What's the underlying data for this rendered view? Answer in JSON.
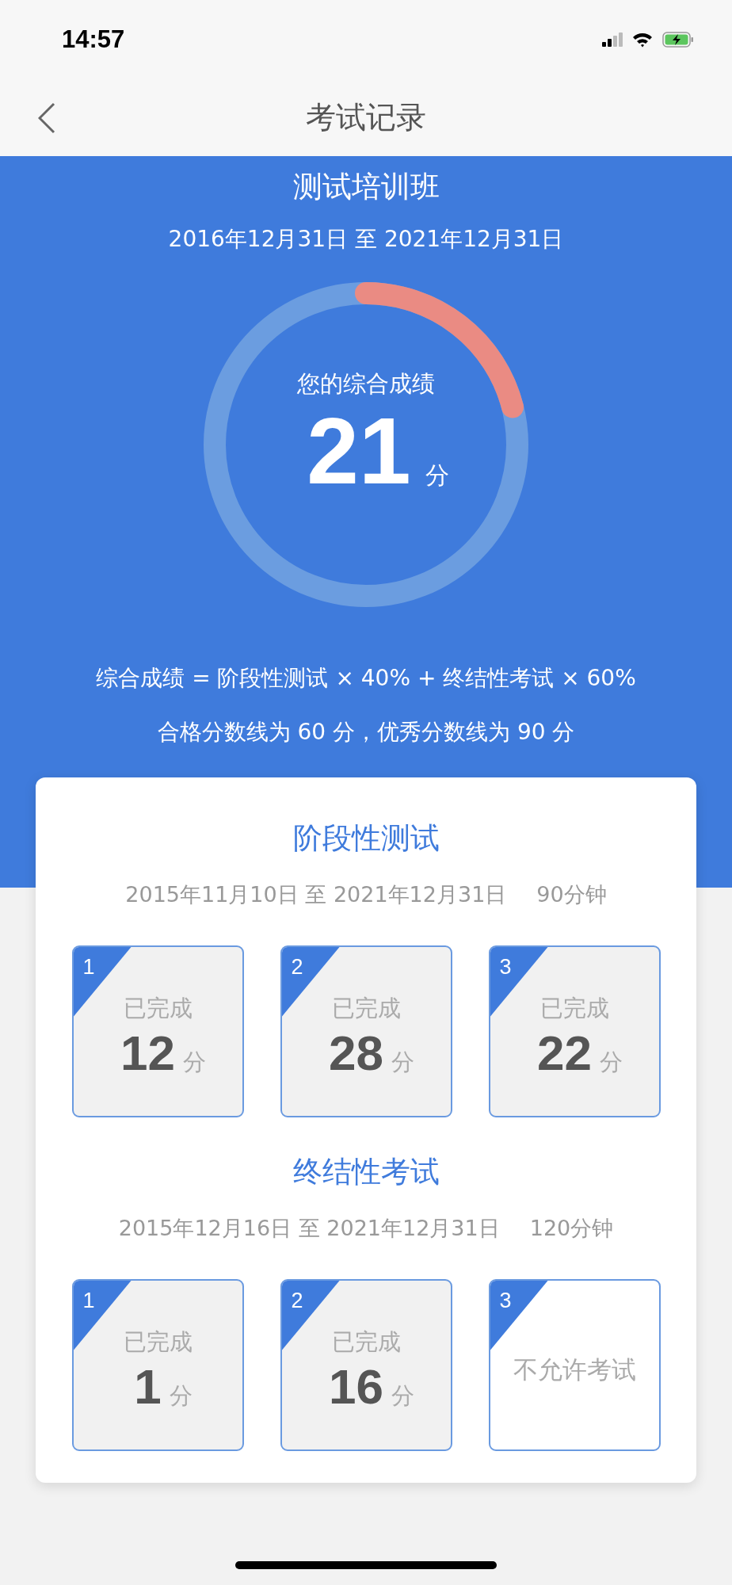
{
  "status_bar": {
    "time": "14:57"
  },
  "nav": {
    "title": "考试记录"
  },
  "course": {
    "name": "测试培训班",
    "period": "2016年12月31日 至 2021年12月31日"
  },
  "score": {
    "label": "您的综合成绩",
    "value": "21",
    "unit": "分"
  },
  "formula": "综合成绩 = 阶段性测试 × 40% + 终结性考试 × 60%",
  "thresholds": "合格分数线为 60 分，优秀分数线为 90 分",
  "sections": [
    {
      "title": "阶段性测试",
      "period": "2015年11月10日 至 2021年12月31日",
      "duration": "90分钟",
      "exams": [
        {
          "number": "1",
          "kind": "done",
          "status": "已完成",
          "score": "12",
          "unit": "分"
        },
        {
          "number": "2",
          "kind": "done",
          "status": "已完成",
          "score": "28",
          "unit": "分"
        },
        {
          "number": "3",
          "kind": "done",
          "status": "已完成",
          "score": "22",
          "unit": "分"
        }
      ]
    },
    {
      "title": "终结性考试",
      "period": "2015年12月16日 至 2021年12月31日",
      "duration": "120分钟",
      "exams": [
        {
          "number": "1",
          "kind": "done",
          "status": "已完成",
          "score": "1",
          "unit": "分"
        },
        {
          "number": "2",
          "kind": "done",
          "status": "已完成",
          "score": "16",
          "unit": "分"
        },
        {
          "number": "3",
          "kind": "locked",
          "status": "不允许考试"
        }
      ]
    }
  ]
}
